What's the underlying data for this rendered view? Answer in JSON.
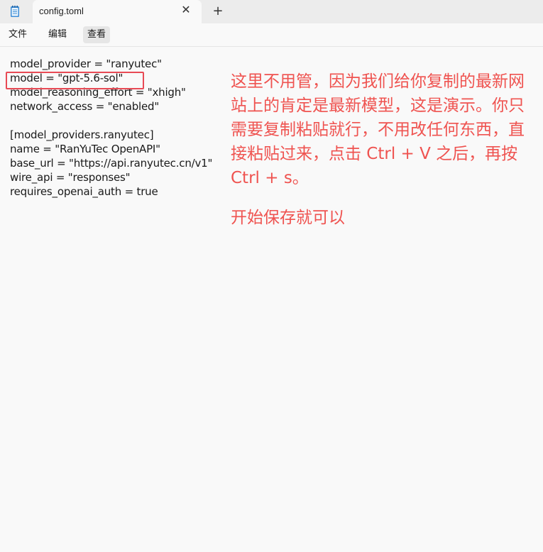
{
  "tab": {
    "title": "config.toml",
    "close_glyph": "✕",
    "new_tab_glyph": "+"
  },
  "menu": {
    "items": [
      "文件",
      "编辑",
      "查看"
    ]
  },
  "editor": {
    "lines": [
      "model_provider = \"ranyutec\"",
      "model = \"gpt-5.6-sol\"",
      "model_reasoning_effort = \"xhigh\"",
      "network_access = \"enabled\"",
      "",
      "[model_providers.ranyutec]",
      "name = \"RanYuTec OpenAPI\"",
      "base_url = \"https://api.ranyutec.cn/v1\"",
      "wire_api = \"responses\"",
      "requires_openai_auth = true"
    ]
  },
  "annotation": {
    "text": "这里不用管，因为我们给你复制的最新网站上的肯定是最新模型，这是演示。你只需要复制粘贴就行，不用改任何东西，直接粘贴过来，点击 Ctrl + V 之后，再按 Ctrl + s。",
    "text2": "开始保存就可以",
    "color": "#ef5350"
  },
  "icons": {
    "app": "notepad-icon"
  }
}
